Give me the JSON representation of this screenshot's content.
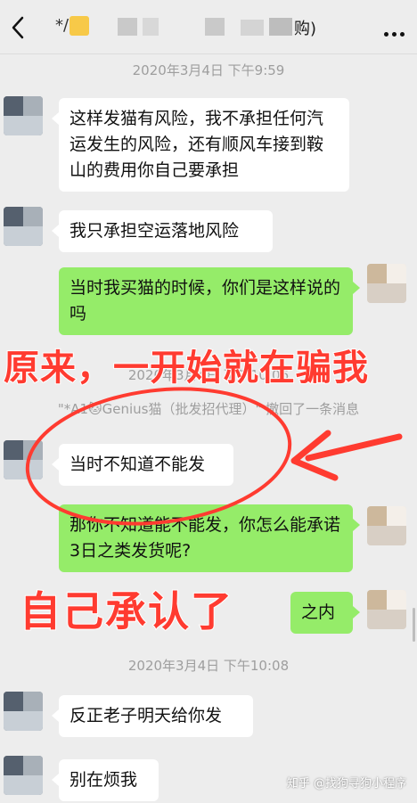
{
  "header": {
    "back_icon": "chevron-left-icon",
    "title_prefix": "*/",
    "title_suffix": "购)",
    "more_icon": "more-dots-icon"
  },
  "timestamps": {
    "t1": "2020年3月4日 下午9:59",
    "t2": "2020年3月4日 下午10:06",
    "t3": "2020年3月4日 下午10:08"
  },
  "messages": {
    "m1": "这样发猫有风险，我不承担任何汽运发生的风险，还有顺风车接到鞍山的费用你自己要承担",
    "m2": "我只承担空运落地风险",
    "m3": "当时我买猫的时候，你们是这样说的吗",
    "m4": "当时不知道不能发",
    "m5": "那你不知道能不能发，你怎么能承诺3日之类发货呢?",
    "m6": "之内",
    "m7": "反正老子明天给你发",
    "m8": "别在烦我"
  },
  "recall_notice": "\"*A1🐱Genius猫（批发招代理）\" 撤回了一条消息",
  "annotations": {
    "caption1": "原来，一开始就在骗我",
    "caption2": "自己承认了"
  },
  "watermark": "知乎 @找狗寻狗小程序",
  "colors": {
    "background": "#ededed",
    "bubble_sent": "#95ec69",
    "bubble_received": "#ffffff",
    "annotation": "#ff3b30"
  }
}
